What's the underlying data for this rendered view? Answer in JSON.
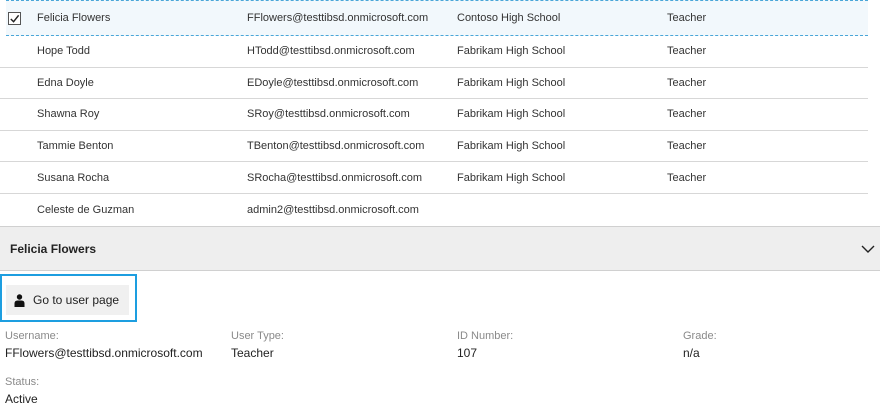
{
  "table": {
    "rows": [
      {
        "name": "Felicia Flowers",
        "email": "FFlowers@testtibsd.onmicrosoft.com",
        "school": "Contoso High School",
        "role": "Teacher",
        "checked": true
      },
      {
        "name": "Hope Todd",
        "email": "HTodd@testtibsd.onmicrosoft.com",
        "school": "Fabrikam High School",
        "role": "Teacher"
      },
      {
        "name": "Edna Doyle",
        "email": "EDoyle@testtibsd.onmicrosoft.com",
        "school": "Fabrikam High School",
        "role": "Teacher"
      },
      {
        "name": "Shawna Roy",
        "email": "SRoy@testtibsd.onmicrosoft.com",
        "school": "Fabrikam High School",
        "role": "Teacher"
      },
      {
        "name": "Tammie Benton",
        "email": "TBenton@testtibsd.onmicrosoft.com",
        "school": "Fabrikam High School",
        "role": "Teacher"
      },
      {
        "name": "Susana Rocha",
        "email": "SRocha@testtibsd.onmicrosoft.com",
        "school": "Fabrikam High School",
        "role": "Teacher"
      },
      {
        "name": "Celeste de Guzman",
        "email": "admin2@testtibsd.onmicrosoft.com",
        "school": "",
        "role": ""
      }
    ]
  },
  "details": {
    "title": "Felicia Flowers",
    "go_to_user_label": "Go to user page",
    "username_label": "Username:",
    "username_value": "FFlowers@testtibsd.onmicrosoft.com",
    "usertype_label": "User Type:",
    "usertype_value": "Teacher",
    "id_label": "ID Number:",
    "id_value": "107",
    "grade_label": "Grade:",
    "grade_value": "n/a",
    "status_label": "Status:",
    "status_value": "Active"
  },
  "colors": {
    "accent": "#1d9ee0",
    "selected_border": "#4aa6d8"
  },
  "icons": {
    "row_check": "checkmark-icon",
    "collapse": "chevron-down-icon",
    "user": "person-icon"
  }
}
